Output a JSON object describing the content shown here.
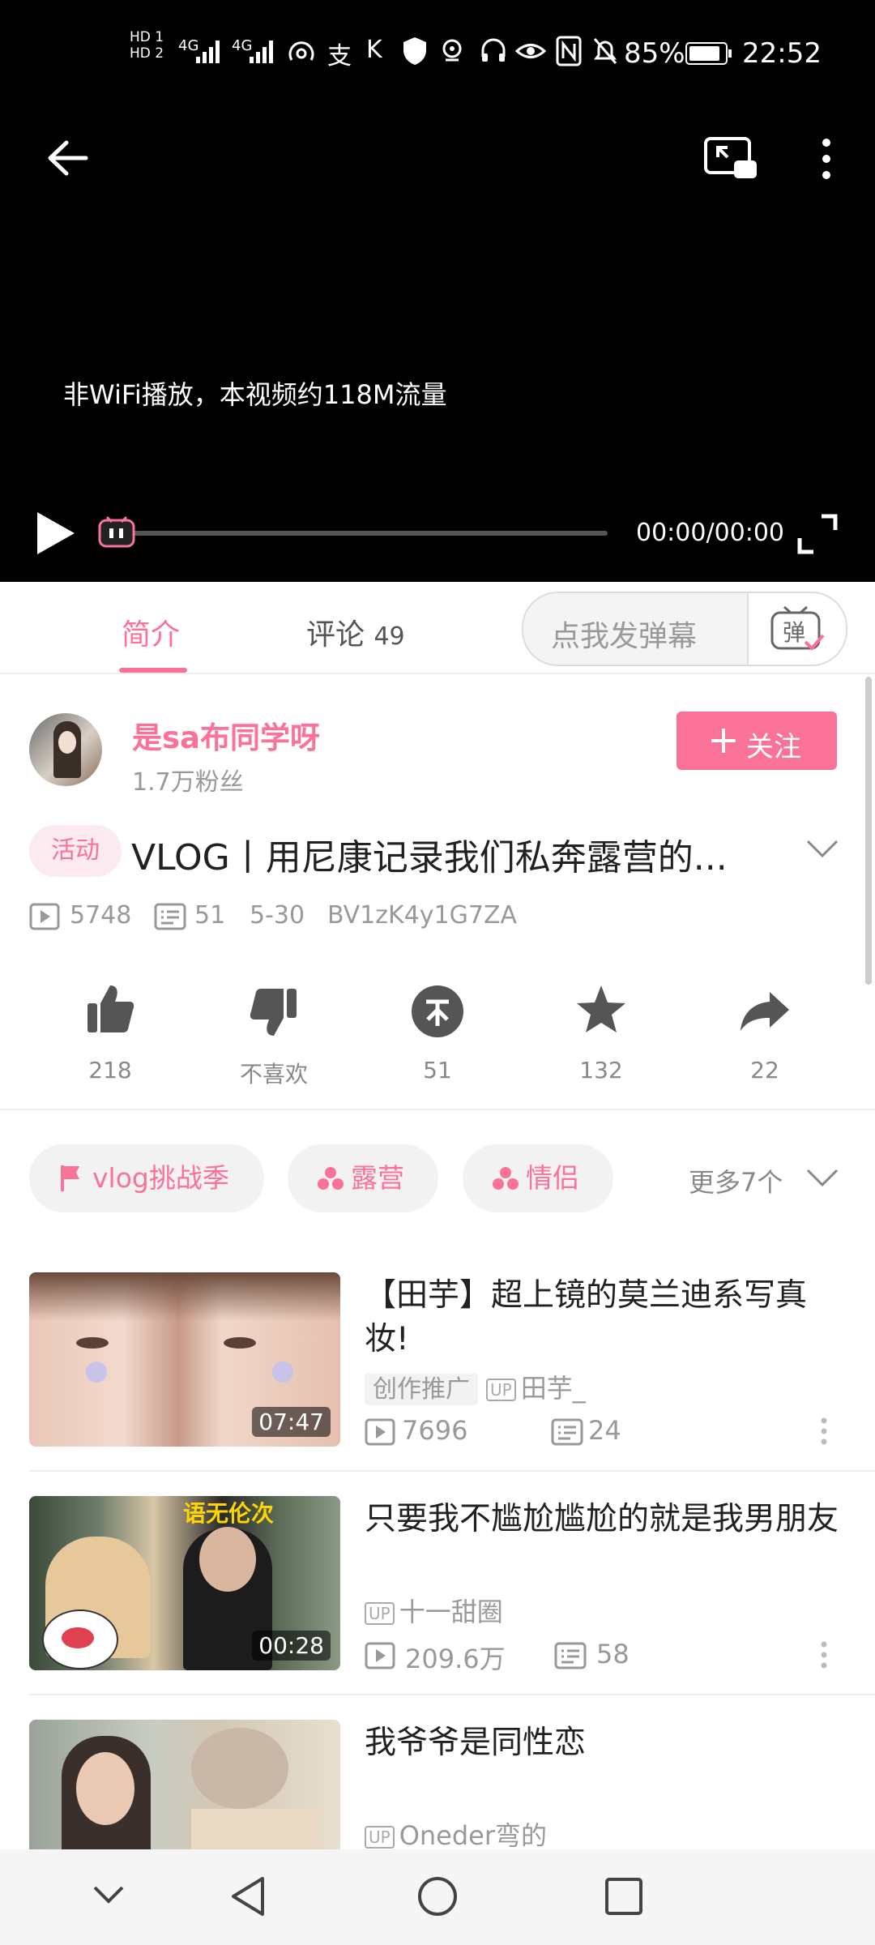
{
  "status_bar": {
    "hd1": "HD 1",
    "hd2": "HD 2",
    "signal1": "4G",
    "signal2": "4G",
    "battery": "85%",
    "time": "22:52"
  },
  "player": {
    "notice": "非WiFi播放，本视频约118M流量",
    "time": "00:00/00:00",
    "progress": 0
  },
  "tabs": {
    "intro": "简介",
    "comments": "评论",
    "comments_count": "49",
    "danmaku_placeholder": "点我发弹幕",
    "danmaku_icon_char": "弹"
  },
  "uploader": {
    "name": "是sa布同学呀",
    "fans": "1.7万粉丝",
    "follow": "关注"
  },
  "video": {
    "badge": "活动",
    "title": "VLOG丨用尼康记录我们私奔露营的...",
    "views": "5748",
    "danmaku": "51",
    "date": "5-30",
    "bvid": "BV1zK4y1G7ZA"
  },
  "actions": {
    "like": "218",
    "dislike": "不喜欢",
    "coin": "51",
    "favorite": "132",
    "share": "22"
  },
  "tags": {
    "items": [
      "vlog挑战季",
      "露营",
      "情侣"
    ],
    "more": "更多7个"
  },
  "recommendations": [
    {
      "title": "【田芋】超上镜的莫兰迪系写真妆!",
      "duration": "07:47",
      "promo": "创作推广",
      "up": "田芋_",
      "views": "7696",
      "danmaku": "24"
    },
    {
      "title": "只要我不尴尬尴尬的就是我男朋友",
      "duration": "00:28",
      "caption": "语无伦次",
      "up": "十一甜圈",
      "views": "209.6万",
      "danmaku": "58"
    },
    {
      "title": "我爷爷是同性恋",
      "up": "Oneder弯的"
    }
  ],
  "up_label": "UP",
  "colors": {
    "accent": "#fb7299"
  }
}
